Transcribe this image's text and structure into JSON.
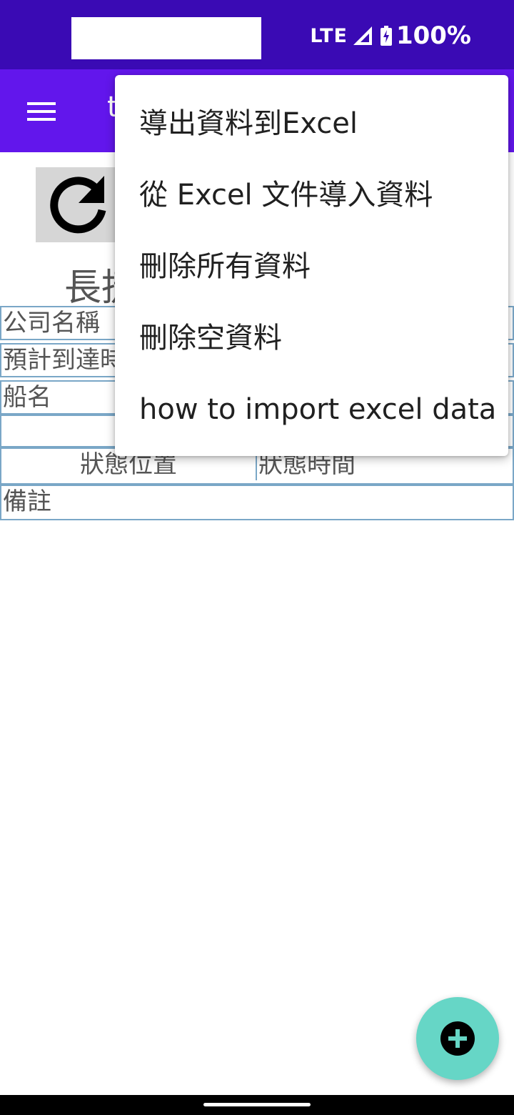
{
  "status_bar": {
    "network": "LTE",
    "battery": "100%",
    "signal_icon": "signal-icon",
    "battery_icon": "battery-charging-icon"
  },
  "app_bar": {
    "title": "t",
    "menu_icon": "menu-icon"
  },
  "main": {
    "refresh_icon": "refresh-icon",
    "heading": "長捷",
    "fields": {
      "company_name": "公司名稱",
      "eta": "預計到達時",
      "ship_name": "船名",
      "status_location": "狀態位置",
      "status_time": "狀態時間",
      "remarks": "備註"
    }
  },
  "overflow_menu": {
    "items": [
      "導出資料到Excel",
      "從 Excel 文件導入資料",
      "刪除所有資料",
      "刪除空資料",
      "how to import excel data"
    ]
  },
  "fab": {
    "icon": "add-icon"
  },
  "colors": {
    "status_bar": "#3a0ab4",
    "app_bar": "#6216ec",
    "fab": "#66d6c6",
    "table_border": "#7aa7c7"
  }
}
